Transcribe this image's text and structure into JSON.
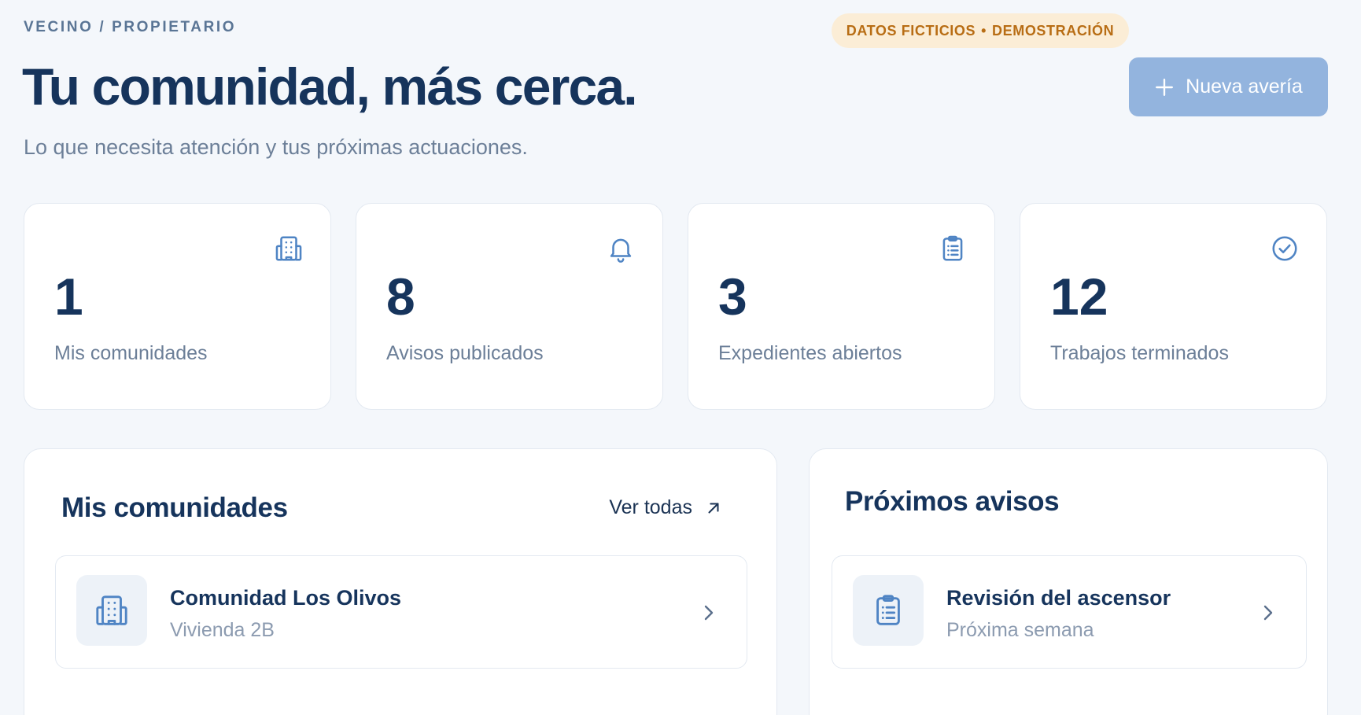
{
  "header": {
    "eyebrow": "VECINO / PROPIETARIO",
    "demo_badge": {
      "left": "DATOS FICTICIOS",
      "separator": "•",
      "right": "DEMOSTRACIÓN"
    },
    "title": "Tu comunidad, más cerca.",
    "subtitle": "Lo que necesita atención y tus próximas actuaciones.",
    "primary_action": {
      "icon": "plus-icon",
      "label": "Nueva avería"
    }
  },
  "stats": [
    {
      "value": "1",
      "label": "Mis comunidades",
      "icon": "building-icon"
    },
    {
      "value": "8",
      "label": "Avisos publicados",
      "icon": "bell-icon"
    },
    {
      "value": "3",
      "label": "Expedientes abiertos",
      "icon": "clipboard-icon"
    },
    {
      "value": "12",
      "label": "Trabajos terminados",
      "icon": "check-circle-icon"
    }
  ],
  "communities_panel": {
    "title": "Mis comunidades",
    "see_all": "Ver todas",
    "see_all_icon": "arrow-up-right-icon",
    "items": [
      {
        "title": "Comunidad Los Olivos",
        "subtitle": "Vivienda 2B",
        "icon": "building-icon"
      }
    ]
  },
  "notices_panel": {
    "title": "Próximos avisos",
    "items": [
      {
        "title": "Revisión del ascensor",
        "subtitle": "Próxima semana",
        "icon": "clipboard-icon"
      }
    ]
  },
  "colors": {
    "background": "#f4f7fb",
    "heading": "#16345c",
    "muted": "#6c7f98",
    "accent": "#4f84c4",
    "primary_button": "#93b4de",
    "badge_bg": "#fbedd6",
    "badge_text": "#b86d14"
  }
}
